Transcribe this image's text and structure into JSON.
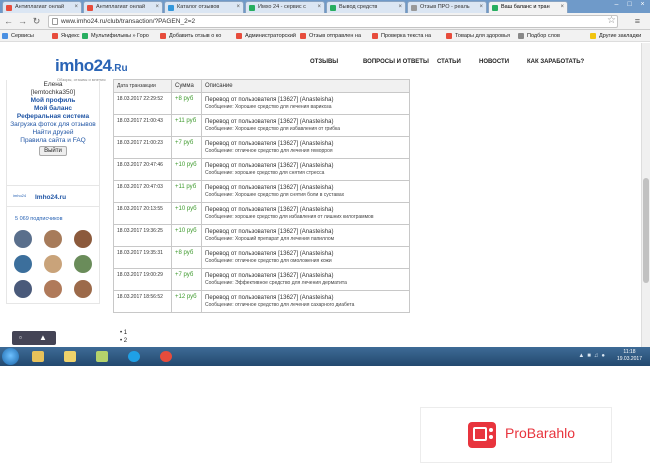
{
  "browser": {
    "tabs": [
      {
        "label": "Антиплагиат онлай",
        "color": "#e74c3c",
        "active": false
      },
      {
        "label": "Антиплагиат онлай",
        "color": "#e74c3c",
        "active": false
      },
      {
        "label": "Каталог отзывов",
        "color": "#3498db",
        "active": false
      },
      {
        "label": "Имхо 24 - сервис с",
        "color": "#27ae60",
        "active": false
      },
      {
        "label": "Вывод средств",
        "color": "#27ae60",
        "active": false
      },
      {
        "label": "Отзыв ПРО - реаль",
        "color": "#999999",
        "active": false
      },
      {
        "label": "Ваш баланс и тран",
        "color": "#27ae60",
        "active": true
      }
    ],
    "url": "www.imho24.ru/club/transaction/?PAGEN_2=2",
    "bookmarks": [
      {
        "label": "Сервисы",
        "color": "#4a90e2"
      },
      {
        "label": "Яндекс",
        "color": "#e74c3c"
      },
      {
        "label": "Мультифильмы » Горо",
        "color": "#27ae60"
      },
      {
        "label": "Добавить отзыв о ко",
        "color": "#e74c3c"
      },
      {
        "label": "Администраторский",
        "color": "#e74c3c"
      },
      {
        "label": "Отзыв отправлен на",
        "color": "#e74c3c"
      },
      {
        "label": "Проверка текста на",
        "color": "#e74c3c"
      },
      {
        "label": "Товары для здоровья",
        "color": "#e74c3c"
      },
      {
        "label": "Подбор слов",
        "color": "#888888"
      },
      {
        "label": "Другие закладки",
        "color": "#f1c40f"
      }
    ]
  },
  "site": {
    "logo": "imho24",
    "logo_ru": ".Ru",
    "tagline": "Обзоры, отзывы и мнения",
    "nav": [
      "ОТЗЫВЫ",
      "ВОПРОСЫ И ОТВЕТЫ",
      "СТАТЬИ",
      "НОВОСТИ",
      "КАК ЗАРАБОТАТЬ?"
    ]
  },
  "sidebar": {
    "name": "Елена",
    "login": "[lemtochka350]",
    "links": [
      {
        "label": "Мой профиль",
        "bold": true
      },
      {
        "label": "Мой баланс",
        "bold": true
      },
      {
        "label": "Реферальная система",
        "bold": true
      },
      {
        "label": "Загрузка фоток для отзывов",
        "bold": false
      },
      {
        "label": "Найти друзей",
        "bold": false
      },
      {
        "label": "Правила сайта и FAQ",
        "bold": false
      }
    ],
    "logout": "Выйти"
  },
  "widget": {
    "logo": "imho24.ru",
    "name": "Imho24.ru",
    "subscribers": "5 069 подписчиков"
  },
  "table": {
    "headers": [
      "Дата транзакции",
      "Сумма",
      "Описание"
    ],
    "rows": [
      {
        "date": "18.03.2017 22:29:52",
        "amount": "+8 руб",
        "desc": "Перевод от пользователя [13627] (Anasteisha)",
        "note": "Сообщение: Хорошее средство для лечения варикоза"
      },
      {
        "date": "18.03.2017 21:00:43",
        "amount": "+11 руб",
        "desc": "Перевод от пользователя [13627] (Anasteisha)",
        "note": "Сообщение: Хорошее средство для избавления от грибка"
      },
      {
        "date": "18.03.2017 21:00:23",
        "amount": "+7 руб",
        "desc": "Перевод от пользователя [13627] (Anasteisha)",
        "note": "Сообщение: отличное средство для лечения геморроя"
      },
      {
        "date": "18.03.2017 20:47:46",
        "amount": "+10 руб",
        "desc": "Перевод от пользователя [13627] (Anasteisha)",
        "note": "Сообщение: хорошее средство для снятия стресса"
      },
      {
        "date": "18.03.2017 20:47:03",
        "amount": "+11 руб",
        "desc": "Перевод от пользователя [13627] (Anasteisha)",
        "note": "Сообщение: Хорошее средство для снятия боли в суставах"
      },
      {
        "date": "18.03.2017 20:13:55",
        "amount": "+10 руб",
        "desc": "Перевод от пользователя [13627] (Anasteisha)",
        "note": "Сообщение: хорошее средство для избавления от лишних килограммов"
      },
      {
        "date": "18.03.2017 19:36:25",
        "amount": "+10 руб",
        "desc": "Перевод от пользователя [13627] (Anasteisha)",
        "note": "Сообщение: Хороший препарат для лечения папиллом"
      },
      {
        "date": "18.03.2017 19:35:31",
        "amount": "+8 руб",
        "desc": "Перевод от пользователя [13627] (Anasteisha)",
        "note": "Сообщение: отличное средство для омоложения кожи"
      },
      {
        "date": "18.03.2017 19:00:29",
        "amount": "+7 руб",
        "desc": "Перевод от пользователя [13627] (Anasteisha)",
        "note": "Сообщение: Эффективное средство для лечения дерматита"
      },
      {
        "date": "18.03.2017 18:56:52",
        "amount": "+12 руб",
        "desc": "Перевод от пользователя [13627] (Anasteisha)",
        "note": "Сообщение: отличное средство для лечения сахарного диабета"
      }
    ]
  },
  "pager": [
    "1",
    "2"
  ],
  "taskbar": {
    "time": "11:18",
    "date": "19.03.2017",
    "apps": [
      {
        "name": "explorer",
        "color": "#e8c25a"
      },
      {
        "name": "files",
        "color": "#f0d36a"
      },
      {
        "name": "notes",
        "color": "#b5d36b"
      },
      {
        "name": "skype",
        "color": "#1fa0e6"
      },
      {
        "name": "chrome",
        "color": "#e74c3c"
      }
    ]
  },
  "watermark": {
    "text": "ProBarahlo"
  }
}
